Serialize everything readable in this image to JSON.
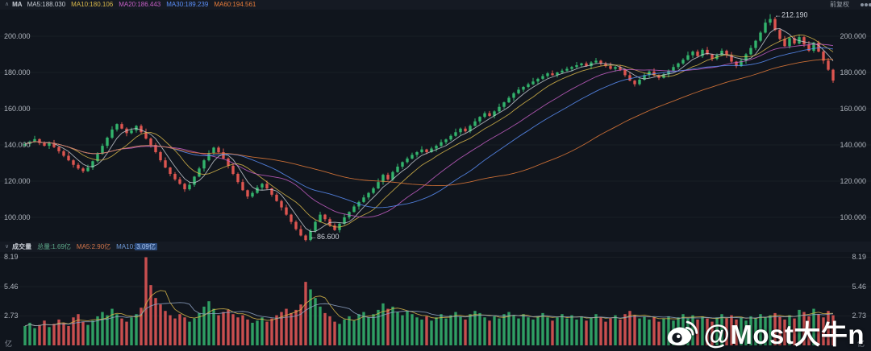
{
  "header": {
    "ma_caret": "∧",
    "ma_label": "MA",
    "ma_items": [
      {
        "label": "MA5:188.030",
        "color": "#c7ccd4"
      },
      {
        "label": "MA10:180.106",
        "color": "#d8b74a"
      },
      {
        "label": "MA20:186.443",
        "color": "#c75fc7"
      },
      {
        "label": "MA30:189.239",
        "color": "#5b8ff9"
      },
      {
        "label": "MA60:194.561",
        "color": "#e87c3a"
      }
    ],
    "adjust_label": "前复权",
    "toolbar_icons": [
      "camera-icon",
      "settings-icon",
      "fullscreen-icon"
    ]
  },
  "volume_header": {
    "caret": "∨",
    "title": "成交量",
    "total": "总量:1.69亿",
    "ma5": "MA5:2.90亿",
    "ma10_label": "MA10:",
    "ma10_value": "3.09亿"
  },
  "watermark": {
    "handle": "@Most大牛n",
    "icon": "weibo-icon"
  },
  "chart_data": {
    "type": "candlestick+volume",
    "title": "",
    "price_axis": {
      "tick_labels": [
        "200.000",
        "180.000",
        "160.000",
        "140.000",
        "120.000",
        "100.000"
      ],
      "tick_values": [
        200,
        180,
        160,
        140,
        120,
        100
      ],
      "range": [
        84,
        214
      ]
    },
    "volume_axis": {
      "tick_labels": [
        "8.19",
        "5.46",
        "2.73"
      ],
      "tick_values": [
        8.19,
        5.46,
        2.73
      ],
      "unit": "亿",
      "range": [
        0,
        8.8
      ]
    },
    "annotations": {
      "high": {
        "text": "←212.190",
        "value": 212.19,
        "index": 154
      },
      "low": {
        "text": "←86.600",
        "value": 86.6,
        "index": 58
      }
    },
    "legend_position": "top-left",
    "grid": false,
    "colors": {
      "up": "#32b36c",
      "down": "#dd5550",
      "vol_up": "#2f9e63",
      "vol_down": "#c94f4f"
    },
    "ma_series": [
      {
        "name": "MA5",
        "period": 5,
        "color": "#c7ccd4"
      },
      {
        "name": "MA10",
        "period": 10,
        "color": "#d8b74a"
      },
      {
        "name": "MA20",
        "period": 20,
        "color": "#c75fc7"
      },
      {
        "name": "MA30",
        "period": 30,
        "color": "#5b8ff9"
      },
      {
        "name": "MA60",
        "period": 60,
        "color": "#e87c3a"
      }
    ],
    "vol_ma_series": [
      {
        "name": "MA5",
        "period": 5,
        "color": "#d8b74a"
      },
      {
        "name": "MA10",
        "period": 10,
        "color": "#8fa3c4"
      }
    ],
    "first_open": 139.6,
    "closes": [
      140.5,
      141.8,
      143.2,
      141.0,
      139.5,
      141.2,
      138.8,
      136.5,
      134.0,
      131.5,
      129.0,
      127.0,
      125.5,
      127.5,
      131.0,
      135.0,
      139.5,
      144.0,
      148.5,
      151.5,
      149.0,
      146.5,
      148.0,
      150.5,
      147.0,
      143.5,
      140.0,
      136.0,
      131.5,
      127.5,
      124.0,
      121.0,
      118.5,
      115.5,
      118.0,
      122.5,
      127.0,
      131.5,
      135.5,
      138.5,
      136.0,
      132.5,
      128.5,
      124.0,
      119.5,
      115.0,
      111.5,
      113.5,
      116.5,
      118.5,
      116.0,
      112.5,
      109.0,
      105.5,
      101.5,
      97.5,
      93.5,
      90.0,
      87.5,
      92.5,
      97.5,
      101.5,
      99.0,
      95.5,
      93.0,
      96.5,
      100.0,
      103.0,
      106.0,
      108.5,
      111.0,
      113.5,
      116.0,
      119.5,
      123.5,
      121.0,
      125.0,
      128.0,
      130.5,
      132.5,
      134.5,
      136.0,
      137.5,
      136.0,
      138.0,
      139.5,
      141.5,
      143.0,
      145.0,
      147.0,
      149.0,
      147.5,
      150.5,
      153.0,
      155.5,
      157.5,
      156.0,
      158.5,
      161.0,
      163.5,
      166.0,
      168.5,
      170.5,
      172.0,
      173.5,
      175.0,
      176.5,
      178.0,
      179.5,
      178.5,
      180.0,
      181.0,
      182.0,
      183.0,
      184.0,
      185.0,
      183.5,
      185.5,
      186.5,
      185.0,
      183.5,
      182.0,
      183.0,
      181.5,
      178.5,
      175.5,
      173.5,
      176.0,
      178.5,
      180.5,
      178.5,
      177.0,
      179.0,
      181.0,
      183.0,
      185.0,
      187.0,
      189.5,
      191.5,
      189.0,
      192.5,
      190.0,
      187.5,
      189.5,
      192.0,
      189.5,
      186.0,
      183.5,
      186.5,
      190.0,
      193.5,
      197.5,
      202.0,
      207.5,
      209.5,
      203.5,
      198.5,
      194.5,
      199.0,
      196.0,
      199.5,
      195.5,
      192.0,
      196.5,
      191.5,
      186.5,
      181.5,
      175.5
    ],
    "volumes": [
      1.8,
      2.1,
      1.6,
      1.9,
      2.3,
      1.7,
      2.0,
      2.4,
      2.1,
      1.8,
      2.6,
      2.9,
      2.2,
      1.9,
      2.3,
      2.7,
      3.1,
      2.8,
      3.4,
      2.9,
      2.5,
      2.2,
      2.6,
      2.9,
      3.5,
      8.19,
      5.6,
      4.4,
      3.8,
      3.2,
      2.8,
      2.5,
      2.9,
      2.6,
      2.2,
      2.5,
      3.0,
      3.6,
      4.1,
      3.4,
      2.8,
      3.1,
      3.3,
      2.9,
      2.6,
      2.8,
      2.4,
      2.1,
      2.3,
      2.6,
      2.2,
      2.5,
      2.8,
      3.1,
      3.4,
      3.0,
      3.3,
      3.8,
      5.9,
      5.2,
      4.4,
      3.6,
      3.0,
      2.7,
      2.2,
      2.0,
      2.4,
      2.7,
      2.3,
      2.9,
      3.1,
      2.6,
      2.9,
      3.3,
      3.9,
      3.4,
      3.6,
      3.1,
      2.8,
      3.2,
      2.9,
      2.6,
      2.4,
      2.7,
      2.3,
      2.6,
      2.9,
      2.5,
      2.8,
      3.1,
      2.7,
      2.4,
      2.9,
      3.2,
      3.0,
      2.6,
      2.3,
      2.7,
      2.5,
      2.9,
      3.1,
      2.8,
      2.5,
      2.9,
      2.6,
      2.4,
      2.7,
      3.0,
      2.6,
      2.3,
      2.6,
      2.9,
      2.5,
      2.8,
      2.4,
      2.7,
      2.3,
      2.6,
      2.9,
      2.6,
      2.2,
      2.5,
      2.8,
      2.4,
      2.9,
      3.2,
      2.8,
      2.5,
      2.7,
      2.4,
      2.6,
      2.2,
      2.5,
      2.7,
      2.3,
      2.6,
      2.9,
      2.5,
      2.8,
      2.4,
      2.7,
      2.5,
      2.2,
      2.6,
      2.9,
      2.5,
      2.8,
      2.4,
      2.6,
      2.3,
      2.7,
      2.5,
      2.9,
      2.6,
      2.8,
      3.0,
      2.7,
      2.4,
      2.8,
      2.5,
      3.3,
      3.1,
      2.7,
      3.4,
      2.9,
      2.6,
      3.2,
      2.8
    ],
    "wick_hi": [
      1.2,
      0.6,
      1.8,
      0.4,
      1.0,
      0.7,
      1.5,
      0.5,
      0.9,
      2.0,
      0.6,
      1.1,
      0.8,
      1.6,
      0.4,
      1.0
    ],
    "wick_lo": [
      0.5,
      1.4,
      0.7,
      1.1,
      0.4,
      1.7,
      0.6,
      1.2,
      0.8,
      0.5,
      1.5,
      0.7,
      1.0,
      0.4,
      1.3,
      0.8
    ]
  }
}
